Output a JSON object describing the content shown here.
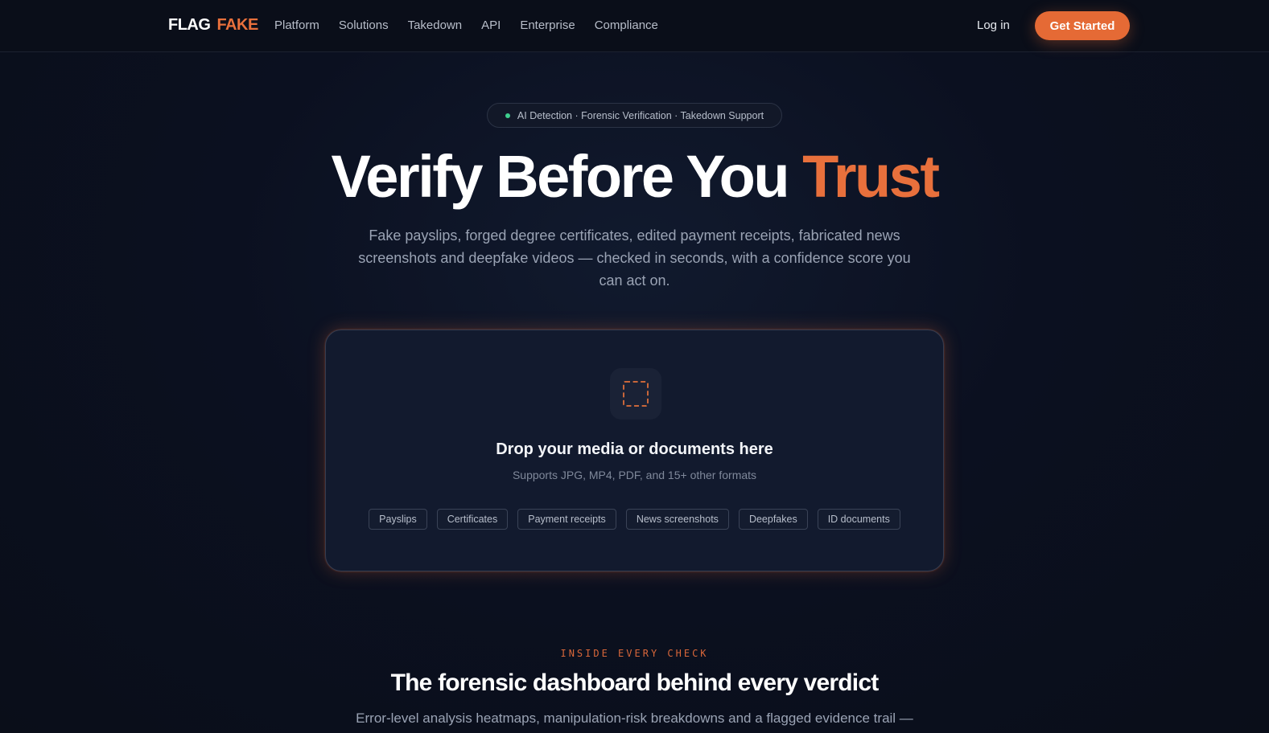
{
  "header": {
    "logo_part1": "FLAG",
    "logo_part2": "FAKE",
    "nav": [
      "Platform",
      "Solutions",
      "Takedown",
      "API",
      "Enterprise",
      "Compliance"
    ],
    "login": "Log in",
    "cta": "Get Started"
  },
  "hero": {
    "pill": "AI Detection · Forensic Verification · Takedown Support",
    "title_main": "Verify Before You",
    "title_accent": "Trust",
    "subtitle": "Fake payslips, forged degree certificates, edited payment receipts, fabricated news screenshots and deepfake videos — checked in seconds, with a confidence score you can act on."
  },
  "dropzone": {
    "icon": "upload-dashed-square-icon",
    "title": "Drop your media or documents here",
    "subtitle": "Supports JPG, MP4, PDF, and 15+ other formats",
    "chips": [
      "Payslips",
      "Certificates",
      "Payment receipts",
      "News screenshots",
      "Deepfakes",
      "ID documents"
    ]
  },
  "section": {
    "eyebrow": "INSIDE EVERY CHECK",
    "title": "The forensic dashboard behind every verdict",
    "subtitle": "Error-level analysis heatmaps, manipulation-risk breakdowns and a flagged evidence trail —"
  },
  "colors": {
    "accent": "#e8703c",
    "background": "#0b0f1a",
    "status_dot": "#3ecf8e"
  }
}
